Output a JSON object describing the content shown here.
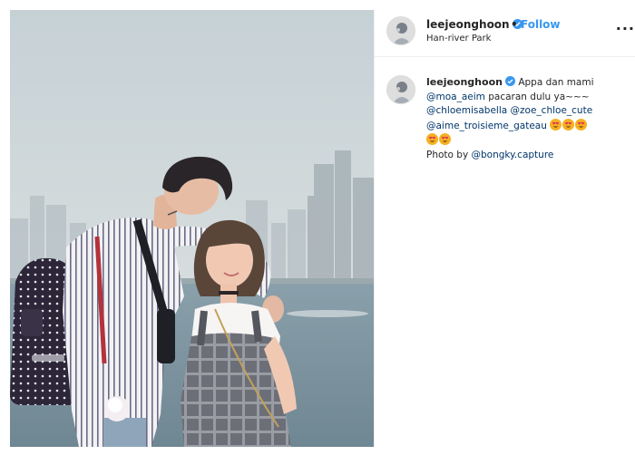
{
  "post": {
    "username": "leejeonghoon",
    "verified": true,
    "follow_label": "Follow",
    "separator": "•",
    "location": "Han-river Park",
    "more_label": "...",
    "image": {
      "alt": "photo"
    }
  },
  "caption": {
    "username": "leejeonghoon",
    "text_line1": "Appa dan mami",
    "mention_moa": "@moa_aeim",
    "text_line2": "pacaran dulu ya~~~",
    "mention_chloe": "@chloemisabella",
    "mention_zoe": "@zoe_chloe_cute",
    "mention_aime": "@aime_troisieme_gateau",
    "photo_credit_prefix": "Photo by",
    "mention_photographer": "@bongky.capture",
    "emoji": "heart-eyes-emoji"
  },
  "colors": {
    "link": "#3897f0",
    "mention": "#003569",
    "text": "#262626",
    "border": "#efefef"
  }
}
